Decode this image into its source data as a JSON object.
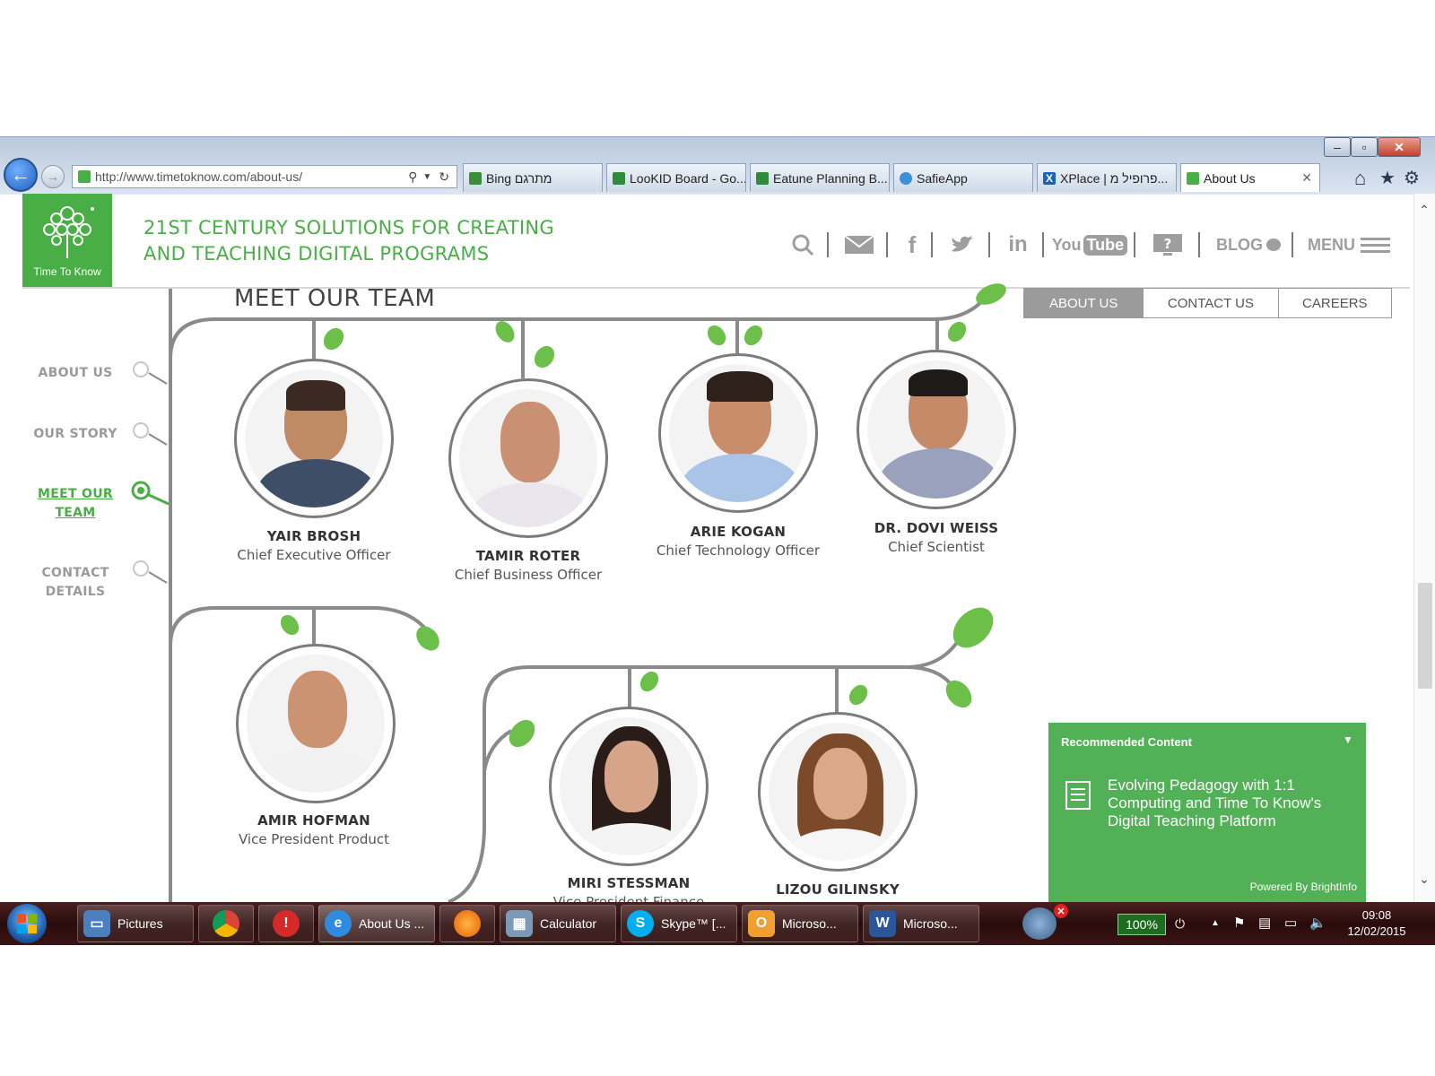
{
  "browser": {
    "url": "http://www.timetoknow.com/about-us/",
    "tabs": [
      {
        "label": "Bing מתרגם",
        "active": false
      },
      {
        "label": "LooKID Board - Go...",
        "active": false
      },
      {
        "label": "Eatune Planning B...",
        "active": false
      },
      {
        "label": "SafieApp",
        "active": false
      },
      {
        "label": "XPlace | פרופיל מ...",
        "active": false
      },
      {
        "label": "About Us",
        "active": true
      }
    ]
  },
  "header": {
    "logo_text": "Time To Know",
    "tagline_line1": "21ST CENTURY SOLUTIONS FOR CREATING",
    "tagline_line2": "AND TEACHING DIGITAL PROGRAMS",
    "youtube_you": "You",
    "youtube_tube": "Tube",
    "blog_label": "BLOG",
    "menu_label": "MENU",
    "brand_color": "#4aae47"
  },
  "subnav": {
    "items": [
      {
        "label": "ABOUT US",
        "active": true
      },
      {
        "label": "CONTACT US",
        "active": false
      },
      {
        "label": "CAREERS",
        "active": false
      }
    ]
  },
  "sidebar": {
    "items": [
      {
        "line1": "ABOUT US",
        "line2": "",
        "active": false
      },
      {
        "line1": "OUR STORY",
        "line2": "",
        "active": false
      },
      {
        "line1": "MEET OUR",
        "line2": "TEAM",
        "active": true
      },
      {
        "line1": "CONTACT",
        "line2": "DETAILS",
        "active": false
      }
    ]
  },
  "main": {
    "title": "MEET OUR TEAM",
    "team": [
      {
        "name": "YAIR BROSH",
        "role": "Chief Executive Officer"
      },
      {
        "name": "TAMIR ROTER",
        "role": "Chief Business Officer"
      },
      {
        "name": "ARIE KOGAN",
        "role": "Chief Technology Officer"
      },
      {
        "name": "DR. DOVI WEISS",
        "role": "Chief Scientist"
      },
      {
        "name": "AMIR HOFMAN",
        "role": "Vice President Product"
      },
      {
        "name": "MIRI STESSMAN",
        "role": "Vice President Finance"
      },
      {
        "name": "LIZOU GILINSKY",
        "role": ""
      }
    ]
  },
  "recommended": {
    "heading": "Recommended Content",
    "article_title": "Evolving Pedagogy with 1:1 Computing and Time To Know's Digital Teaching Platform",
    "footer": "Powered By BrightInfo"
  },
  "taskbar": {
    "items": [
      {
        "label": "Pictures",
        "icon": "pictures-icon"
      },
      {
        "label": "",
        "icon": "chrome-icon"
      },
      {
        "label": "",
        "icon": "app-icon"
      },
      {
        "label": "About Us ...",
        "icon": "ie-icon"
      },
      {
        "label": "",
        "icon": "firefox-icon"
      },
      {
        "label": "Calculator",
        "icon": "calculator-icon"
      },
      {
        "label": "Skype™ [...",
        "icon": "skype-icon"
      },
      {
        "label": "Microso...",
        "icon": "outlook-icon"
      },
      {
        "label": "Microso...",
        "icon": "word-icon"
      }
    ],
    "battery": "100%",
    "time": "09:08",
    "date": "12/02/2015"
  }
}
